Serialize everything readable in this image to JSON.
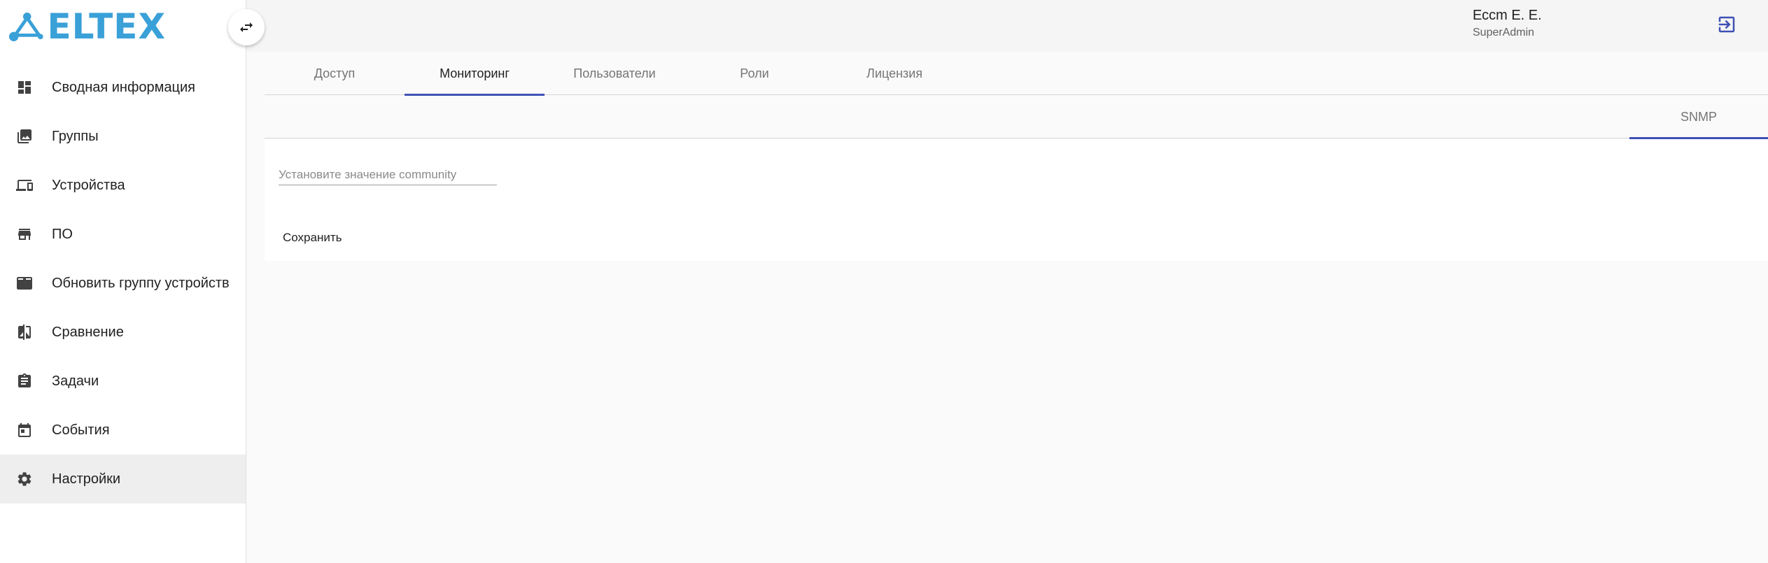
{
  "brand": {
    "name": "ELTEX",
    "color": "#3aa0d8"
  },
  "sidebar": {
    "items": [
      {
        "label": "Сводная информация",
        "icon": "dashboard-icon"
      },
      {
        "label": "Группы",
        "icon": "photo-library-icon"
      },
      {
        "label": "Устройства",
        "icon": "devices-icon"
      },
      {
        "label": "ПО",
        "icon": "store-icon"
      },
      {
        "label": "Обновить группу устройств",
        "icon": "system-update-icon"
      },
      {
        "label": "Сравнение",
        "icon": "compare-icon"
      },
      {
        "label": "Задачи",
        "icon": "assignment-icon"
      },
      {
        "label": "События",
        "icon": "event-icon"
      },
      {
        "label": "Настройки",
        "icon": "settings-icon",
        "active": true
      }
    ]
  },
  "header": {
    "user_name": "Ессm Е. Е.",
    "user_role": "SuperAdmin"
  },
  "tabs": [
    {
      "label": "Доступ"
    },
    {
      "label": "Мониторинг",
      "active": true
    },
    {
      "label": "Пользователи"
    },
    {
      "label": "Роли"
    },
    {
      "label": "Лицензия"
    }
  ],
  "subtabs": [
    {
      "label": "SNMP",
      "active": true
    }
  ],
  "form": {
    "community_placeholder": "Установите значение community",
    "community_value": "",
    "save_label": "Сохранить"
  },
  "colors": {
    "accent": "#3f51b5",
    "icon": "#424242"
  }
}
